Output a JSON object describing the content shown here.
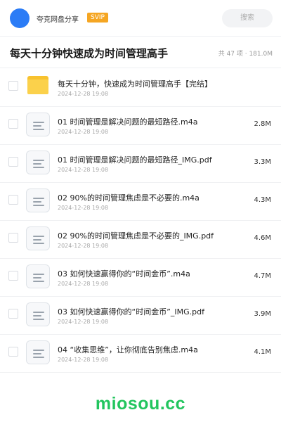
{
  "header": {
    "app_name": "夸克网盘分享",
    "badge": "SVIP",
    "search_placeholder": "搜索",
    "avatar_color": "#2b7cf6",
    "badge_color": "#f5a623"
  },
  "folder_title": "每天十分钟快速成为时间管理高手",
  "folder_meta": "共 47 项 · 181.0M",
  "items": [
    {
      "type": "folder",
      "name": "每天十分钟，快速成为时间管理高手【完结】",
      "date": "2024-12-28 19:08",
      "size": ""
    },
    {
      "type": "file",
      "name": "01 时间管理是解决问题的最短路径.m4a",
      "date": "2024-12-28 19:08",
      "size": "2.8M"
    },
    {
      "type": "file",
      "name": "01 时间管理是解决问题的最短路径_IMG.pdf",
      "date": "2024-12-28 19:08",
      "size": "3.3M"
    },
    {
      "type": "file",
      "name": "02 90%的时间管理焦虑是不必要的.m4a",
      "date": "2024-12-28 19:08",
      "size": "4.3M"
    },
    {
      "type": "file",
      "name": "02 90%的时间管理焦虑是不必要的_IMG.pdf",
      "date": "2024-12-28 19:08",
      "size": "4.6M"
    },
    {
      "type": "file",
      "name": "03 如何快速赢得你的“时间金币”.m4a",
      "date": "2024-12-28 19:08",
      "size": "4.7M"
    },
    {
      "type": "file",
      "name": "03 如何快速赢得你的“时间金币”_IMG.pdf",
      "date": "2024-12-28 19:08",
      "size": "3.9M"
    },
    {
      "type": "file",
      "name": "04 “收集思维”，让你彻底告别焦虑.m4a",
      "date": "2024-12-28 19:08",
      "size": "4.1M"
    }
  ],
  "footer": {
    "brand": "miosou.cc",
    "brand_color": "#22c55e"
  }
}
